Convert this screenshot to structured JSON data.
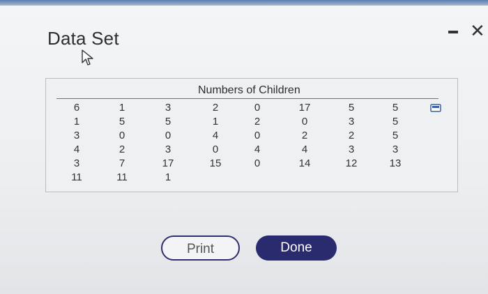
{
  "window": {
    "title": "Data Set"
  },
  "controls": {
    "minimize_icon": "minimize-icon",
    "close_label": "✕"
  },
  "table": {
    "caption": "Numbers of Children",
    "columns": [
      [
        "6",
        "1",
        "3",
        "4",
        "3",
        "11"
      ],
      [
        "1",
        "5",
        "0",
        "2",
        "7",
        "11"
      ],
      [
        "3",
        "5",
        "0",
        "3",
        "17",
        "1"
      ],
      [
        "2",
        "1",
        "4",
        "0",
        "15"
      ],
      [
        "0",
        "2",
        "0",
        "4",
        "0"
      ],
      [
        "17",
        "0",
        "2",
        "4",
        "14"
      ],
      [
        "5",
        "3",
        "2",
        "3",
        "12"
      ],
      [
        "5",
        "5",
        "5",
        "3",
        "13"
      ]
    ]
  },
  "buttons": {
    "print": "Print",
    "done": "Done"
  }
}
